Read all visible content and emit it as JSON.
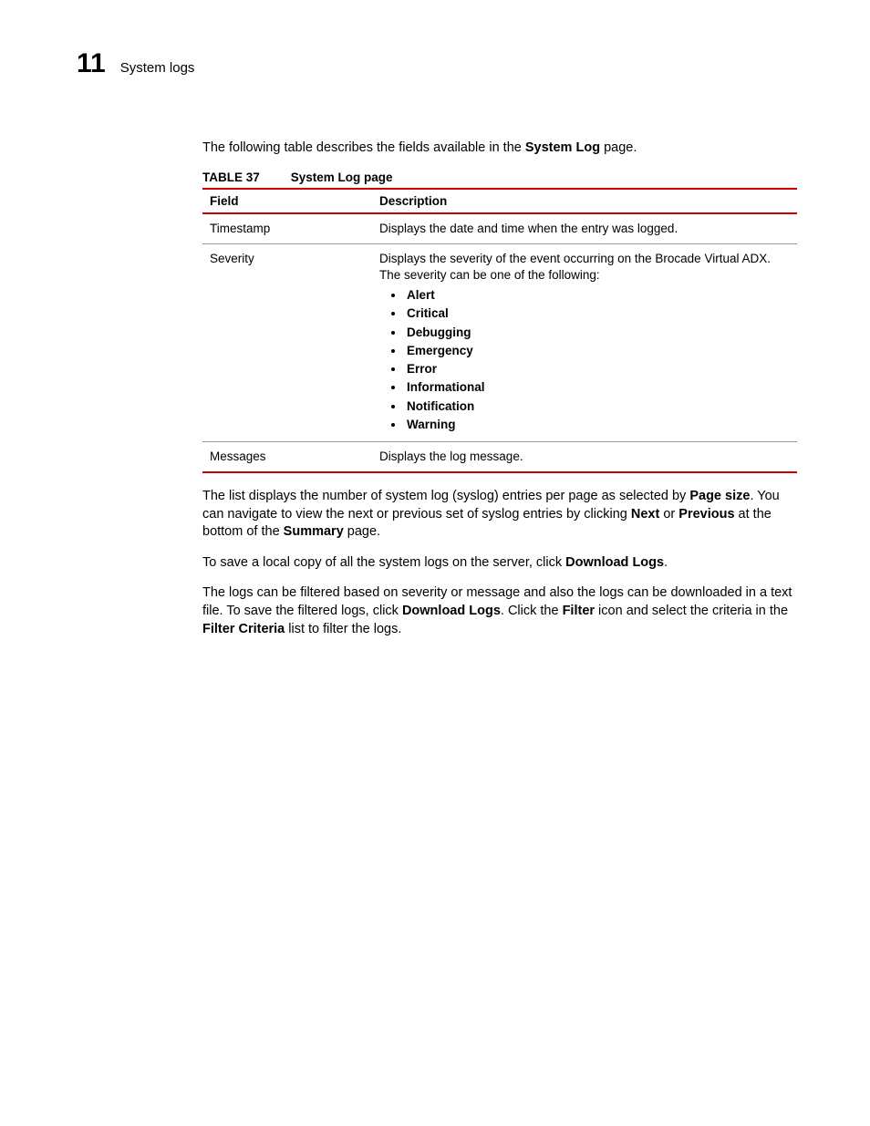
{
  "header": {
    "chapter_number": "11",
    "chapter_title": "System logs"
  },
  "intro": {
    "pre": "The following table describes the fields available in the ",
    "bold": "System Log",
    "post": " page."
  },
  "table_caption": {
    "number": "TABLE 37",
    "title": "System Log page"
  },
  "table": {
    "head": {
      "field": "Field",
      "description": "Description"
    },
    "rows": [
      {
        "field": "Timestamp",
        "description": "Displays the date and time when the entry was logged."
      },
      {
        "field": "Severity",
        "description": "Displays the severity of the event occurring on the Brocade Virtual ADX. The severity can be one of the following:",
        "list": [
          "Alert",
          "Critical",
          "Debugging",
          "Emergency",
          "Error",
          "Informational",
          "Notification",
          "Warning"
        ]
      },
      {
        "field": "Messages",
        "description": "Displays the log message."
      }
    ]
  },
  "para1": {
    "t1": "The list displays the number of system log (syslog) entries per page as selected by ",
    "b1": "Page size",
    "t2": ". You can navigate to view the next or previous set of syslog entries by clicking ",
    "b2": "Next",
    "t3": " or ",
    "b3": "Previous",
    "t4": " at the bottom of the ",
    "b4": "Summary",
    "t5": " page."
  },
  "para2": {
    "t1": "To save a local copy of all the system logs on the server, click ",
    "b1": "Download Logs",
    "t2": "."
  },
  "para3": {
    "t1": "The logs can be filtered based on severity or message and also the logs can be downloaded in a text file. To save the filtered logs, click ",
    "b1": "Download Logs",
    "t2": ". Click the ",
    "b2": "Filter",
    "t3": " icon and select the criteria in the ",
    "b3": "Filter Criteria",
    "t4": " list to filter the logs."
  }
}
